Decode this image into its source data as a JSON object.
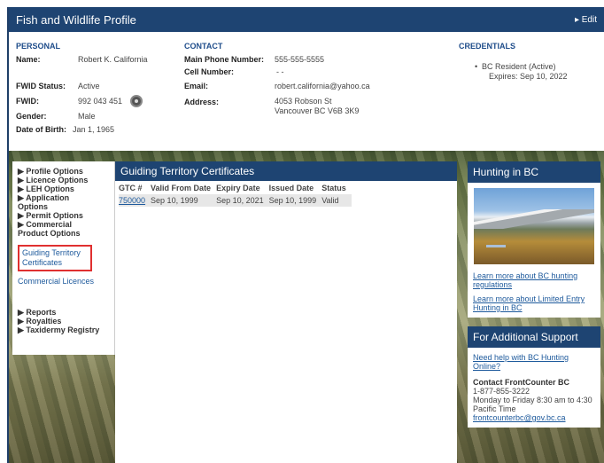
{
  "header": {
    "title": "Fish and Wildlife Profile",
    "edit": "▸ Edit"
  },
  "personal": {
    "heading": "PERSONAL",
    "name_label": "Name:",
    "name": "Robert K. California",
    "fwid_status_label": "FWID Status:",
    "fwid_status": "Active",
    "fwid_label": "FWID:",
    "fwid": "992 043 451",
    "gender_label": "Gender:",
    "gender": "Male",
    "dob_label": "Date of Birth:",
    "dob": "Jan 1, 1965"
  },
  "contact": {
    "heading": "CONTACT",
    "main_phone_label": "Main Phone Number:",
    "main_phone": "555-555-5555",
    "cell_label": "Cell Number:",
    "cell": "- -",
    "email_label": "Email:",
    "email": "robert.california@yahoo.ca",
    "address_label": "Address:",
    "address_line1": "4053 Robson St",
    "address_line2": "Vancouver BC V6B 3K9"
  },
  "credentials": {
    "heading": "CREDENTIALS",
    "item_line1": "BC Resident (Active)",
    "item_line2": "Expires: Sep 10, 2022"
  },
  "nav": {
    "profile_options": "▶ Profile Options",
    "licence_options": "▶ Licence Options",
    "leh_options": "▶ LEH Options",
    "application_options_1": "▶ Application",
    "application_options_2": "Options",
    "permit_options": "▶ Permit Options",
    "commercial_1": "▶ Commercial",
    "commercial_2": "Product Options",
    "guiding_1": "Guiding Territory",
    "guiding_2": "Certificates",
    "commercial_licences": "Commercial Licences",
    "reports": "▶ Reports",
    "royalties": "▶ Royalties",
    "taxidermy": "▶ Taxidermy Registry"
  },
  "main": {
    "title": "Guiding Territory Certificates",
    "columns": [
      "GTC #",
      "Valid From Date",
      "Expiry Date",
      "Issued Date",
      "Status"
    ],
    "row": {
      "gtc": "750000",
      "valid_from": "Sep 10, 1999",
      "expiry": "Sep 10, 2021",
      "issued": "Sep 10, 1999",
      "status": "Valid"
    }
  },
  "sidebar": {
    "hunting_title": "Hunting in BC",
    "link1_a": "Learn more about BC hunting",
    "link1_b": "regulations",
    "link2_a": "Learn more about Limited Entry",
    "link2_b": "Hunting in BC",
    "support_title": "For Additional Support",
    "help_a": "Need help with BC Hunting",
    "help_b": "Online?",
    "contact_title": "Contact FrontCounter BC",
    "phone": "1-877-855-3222",
    "hours_a": "Monday to Friday 8:30 am to 4:30",
    "hours_b": "Pacific Time",
    "email": "frontcounterbc@gov.bc.ca"
  }
}
